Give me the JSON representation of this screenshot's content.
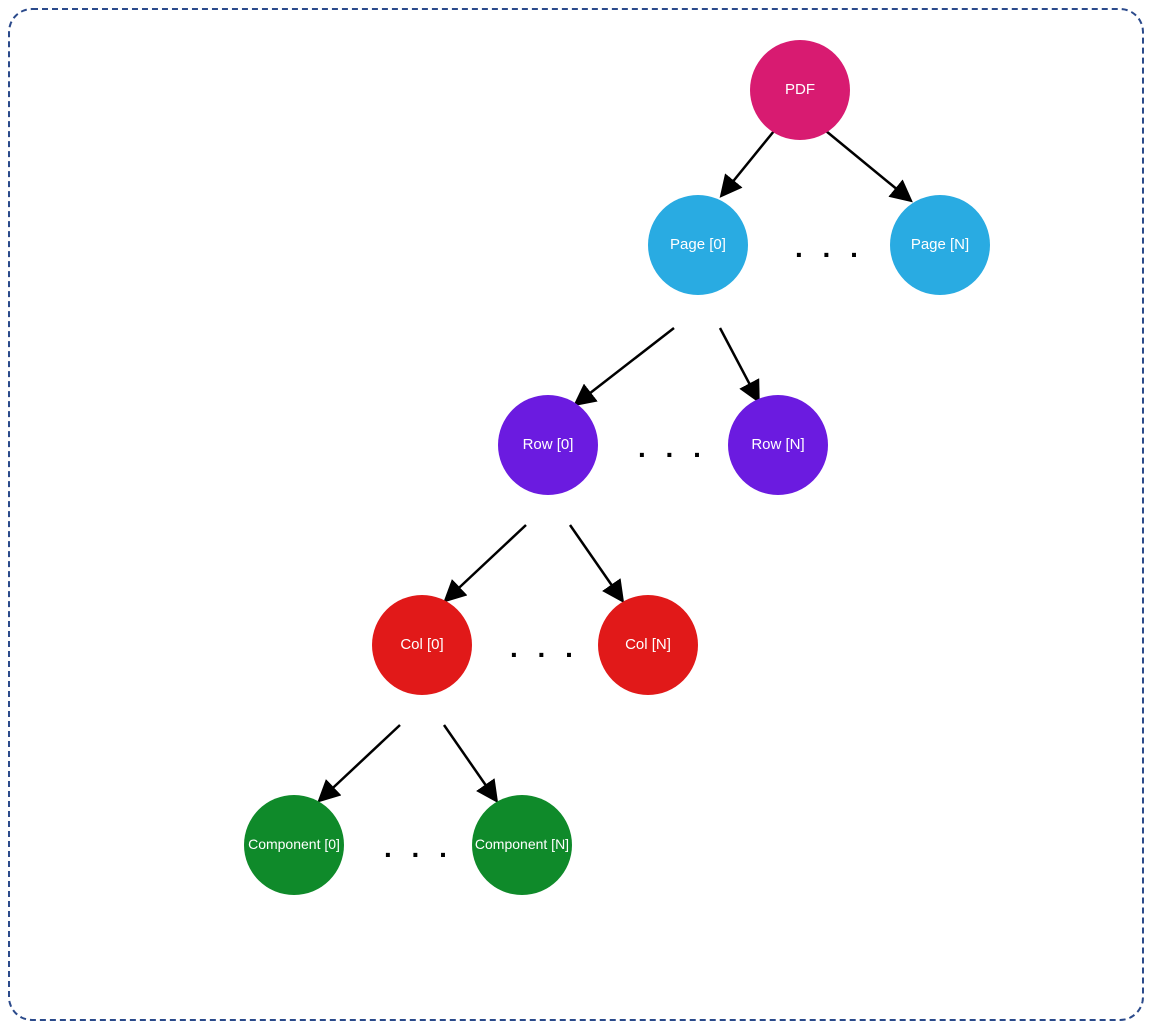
{
  "diagram": {
    "colors": {
      "pdf": "#d81b71",
      "page": "#29abe2",
      "row": "#6b1be0",
      "col": "#e11919",
      "component": "#0f8a2a",
      "border": "#2b4a8b"
    },
    "ellipsis": ". . .",
    "nodes": {
      "pdf": {
        "label": "PDF"
      },
      "page0": {
        "label": "Page [0]"
      },
      "pageN": {
        "label": "Page [N]"
      },
      "row0": {
        "label": "Row [0]"
      },
      "rowN": {
        "label": "Row [N]"
      },
      "col0": {
        "label": "Col [0]"
      },
      "colN": {
        "label": "Col [N]"
      },
      "comp0": {
        "label": "Component [0]"
      },
      "compN": {
        "label": "Component [N]"
      }
    }
  }
}
